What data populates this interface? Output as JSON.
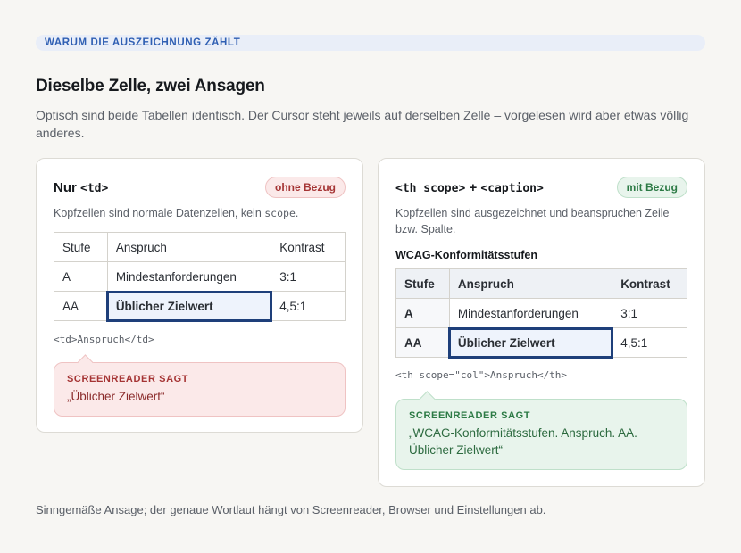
{
  "eyebrow": "WARUM DIE AUSZEICHNUNG ZÄHLT",
  "title": "Dieselbe Zelle, zwei Ansagen",
  "lead": "Optisch sind beide Tabellen identisch. Der Cursor steht jeweils auf derselben Zelle – vorgelesen wird aber etwas völlig anderes.",
  "left": {
    "title_prefix": "Nur ",
    "title_code": "<td>",
    "badge": "ohne Bezug",
    "desc_prefix": "Kopfzellen sind normale Datenzellen, kein ",
    "desc_code": "scope",
    "desc_suffix": ".",
    "table": {
      "header": [
        "Stufe",
        "Anspruch",
        "Kontrast"
      ],
      "rows": [
        [
          "A",
          "Mindestanforderungen",
          "3:1"
        ],
        [
          "AA",
          "Üblicher Zielwert",
          "4,5:1"
        ]
      ]
    },
    "code": "<td>Anspruch</td>",
    "bubble_label": "SCREENREADER SAGT",
    "bubble_text": "„Üblicher Zielwert“"
  },
  "right": {
    "title_code1": "<th scope>",
    "title_plus": " + ",
    "title_code2": "<caption>",
    "badge": "mit Bezug",
    "desc": "Kopfzellen sind ausgezeichnet und beanspruchen Zeile bzw. Spalte.",
    "caption": "WCAG-Konformitätsstufen",
    "table": {
      "header": [
        "Stufe",
        "Anspruch",
        "Kontrast"
      ],
      "rows": [
        [
          "A",
          "Mindestanforderungen",
          "3:1"
        ],
        [
          "AA",
          "Üblicher Zielwert",
          "4,5:1"
        ]
      ]
    },
    "code": "<th scope=\"col\">Anspruch</th>",
    "bubble_label": "SCREENREADER SAGT",
    "bubble_text": "„WCAG-Konformitätsstufen. Anspruch. AA. Üblicher Zielwert“"
  },
  "footnote": "Sinngemäße Ansage; der genaue Wortlaut hängt von Screenreader, Browser und Einstellungen ab.",
  "colors": {
    "accent": "#2f5fb3",
    "focus_outline": "#1e3f7a",
    "negative": "#a53434",
    "positive": "#2c7a45"
  }
}
